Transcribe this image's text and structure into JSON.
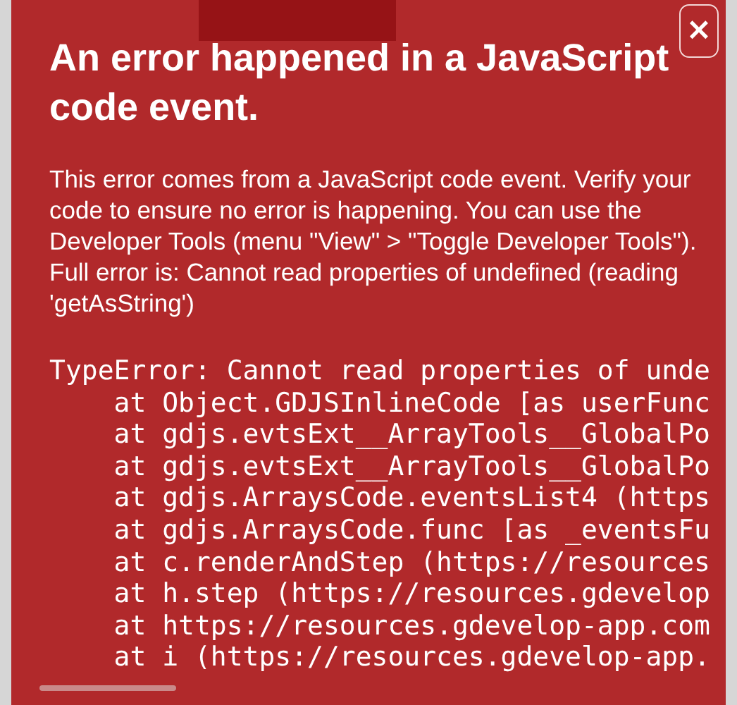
{
  "dialog": {
    "close_button": "×",
    "title": "An error happened in a JavaScript code event.",
    "description": "This error comes from a JavaScript code event. Verify your code to ensure no error is happening. You can use the Developer Tools (menu \"View\" > \"Toggle Developer Tools\"). Full error is: Cannot read properties of undefined (reading 'getAsString')",
    "stack_trace": [
      {
        "kind": "message",
        "text": "TypeError: Cannot read properties of unde"
      },
      {
        "kind": "frame",
        "text": "at Object.GDJSInlineCode [as userFunc"
      },
      {
        "kind": "frame",
        "text": "at gdjs.evtsExt__ArrayTools__GlobalPo"
      },
      {
        "kind": "frame",
        "text": "at gdjs.evtsExt__ArrayTools__GlobalPo"
      },
      {
        "kind": "frame",
        "text": "at gdjs.ArraysCode.eventsList4 (https"
      },
      {
        "kind": "frame",
        "text": "at gdjs.ArraysCode.func [as _eventsFu"
      },
      {
        "kind": "frame",
        "text": "at c.renderAndStep (https://resources"
      },
      {
        "kind": "frame",
        "text": "at h.step (https://resources.gdevelop"
      },
      {
        "kind": "frame",
        "text": "at https://resources.gdevelop-app.com"
      },
      {
        "kind": "frame",
        "text": "at i (https://resources.gdevelop-app."
      }
    ]
  }
}
